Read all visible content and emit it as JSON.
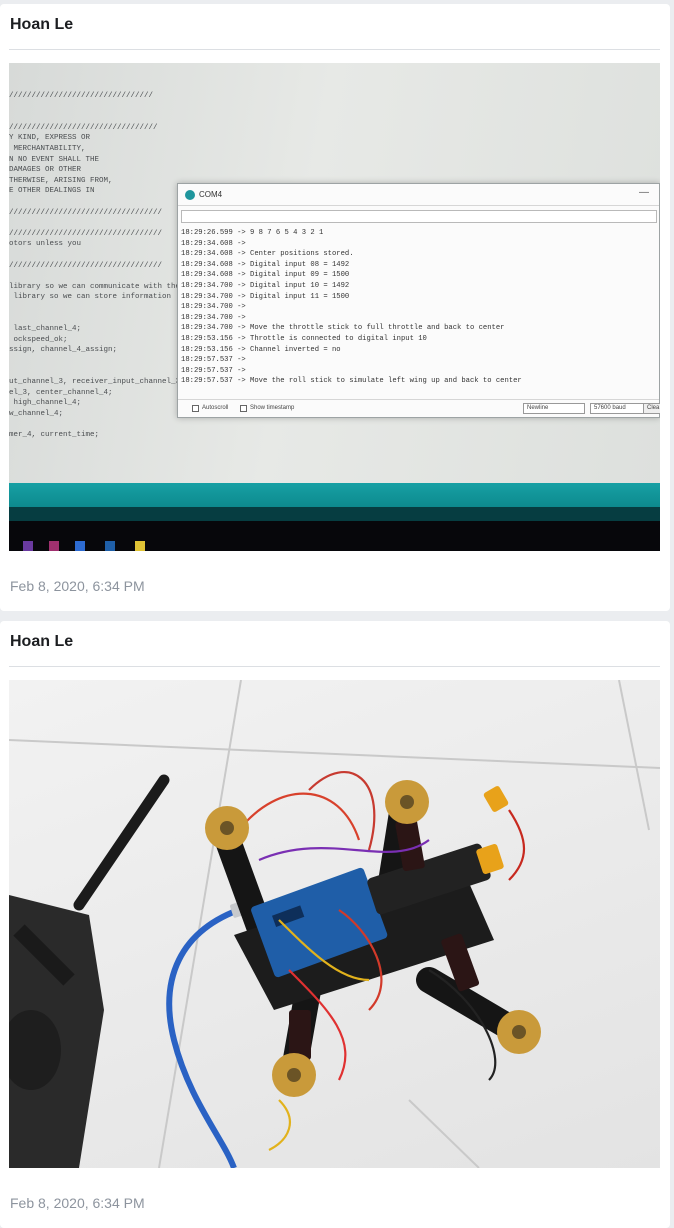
{
  "posts": [
    {
      "author": "Hoan Le",
      "timestamp": "Feb 8, 2020, 6:34 PM",
      "photo": {
        "code_lines": [
          "////////////////////////////////",
          "",
          "",
          "/////////////////////////////////",
          "Y KIND, EXPRESS OR",
          " MERCHANTABILITY,",
          "N NO EVENT SHALL THE",
          "DAMAGES OR OTHER",
          "THERWISE, ARISING FROM,",
          "E OTHER DEALINGS IN",
          "",
          "//////////////////////////////////",
          "",
          "//////////////////////////////////",
          "otors unless you",
          "",
          "//////////////////////////////////",
          "",
          "library so we can communicate with the",
          " library so we can store information",
          "",
          "",
          " last_channel_4;",
          " ockspeed_ok;",
          "ssign, channel_4_assign;",
          "",
          "",
          "ut_channel_3, receiver_input_channel_3,",
          "el_3, center_channel_4;",
          " high_channel_4;",
          "w_channel_4;",
          "",
          "mer_4, current_time;"
        ],
        "window_title": "COM4",
        "serial_lines": [
          "18:29:26.599 -> 9 8 7 6 5 4 3 2 1",
          "18:29:34.608 ->",
          "18:29:34.608 -> Center positions stored.",
          "18:29:34.608 -> Digital input 08 = 1492",
          "18:29:34.608 -> Digital input 09 = 1500",
          "18:29:34.700 -> Digital input 10 = 1492",
          "18:29:34.700 -> Digital input 11 = 1500",
          "18:29:34.700 ->",
          "18:29:34.700 ->",
          "18:29:34.700 -> Move the throttle stick to full throttle and back to center",
          "18:29:53.156 -> Throttle is connected to digital input 10",
          "18:29:53.156 -> Channel inverted = no",
          "18:29:57.537 ->",
          "18:29:57.537 ->",
          "18:29:57.537 -> Move the roll stick to simulate left wing up and back to center"
        ],
        "autoscroll_label": "Autoscroll",
        "timestamp_toggle_label": "Show timestamp",
        "line_ending": "Newline",
        "baud_rate": "57600 baud",
        "clear_label": "Clea"
      }
    },
    {
      "author": "Hoan Le",
      "timestamp": "Feb 8, 2020, 6:34 PM"
    }
  ],
  "colors": {
    "background": "#ebedf0",
    "card": "#ffffff",
    "author_text": "#1c1e21",
    "timestamp_text": "#8d949e",
    "arduino_teal": "#17a0a4"
  }
}
